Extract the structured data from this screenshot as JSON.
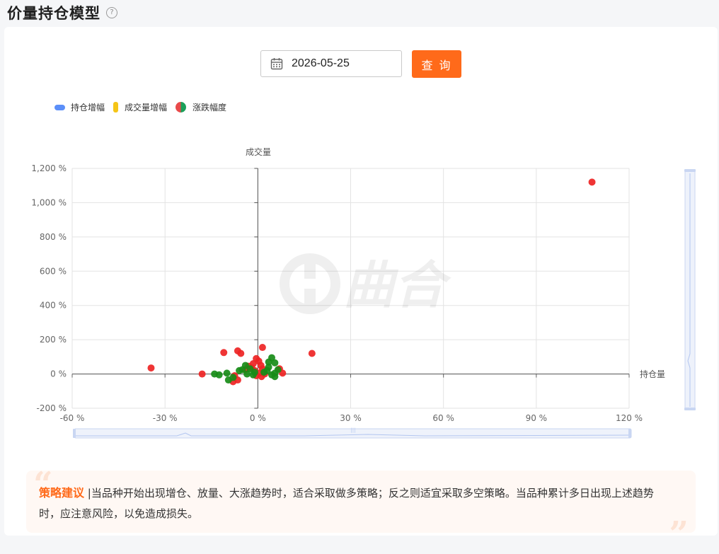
{
  "page": {
    "title": "价量持仓模型",
    "help_icon": "question-circle-icon"
  },
  "query": {
    "date_value": "2026-05-25",
    "button_label": "查 询",
    "calendar_icon": "calendar-icon"
  },
  "legend": [
    {
      "label": "持仓增幅",
      "color": "#5b8ff9",
      "icon": "rounded-bar-icon"
    },
    {
      "label": "成交量增幅",
      "color": "#f5c518",
      "icon": "vertical-bar-icon"
    },
    {
      "label": "涨跌幅度",
      "color": "#e84a4a",
      "icon": "half-red-half-green-circle-icon"
    }
  ],
  "watermark": "曲合",
  "chart_data": {
    "type": "scatter",
    "xlabel": "持仓量",
    "ylabel": "成交量",
    "xlim": [
      -60,
      120
    ],
    "ylim": [
      -200,
      1200
    ],
    "x_ticks": [
      -60,
      -30,
      0,
      30,
      60,
      90,
      120
    ],
    "y_ticks": [
      -200,
      0,
      200,
      400,
      600,
      800,
      1000,
      1200
    ],
    "x_tick_labels": [
      "-60 %",
      "-30 %",
      "0 %",
      "30 %",
      "60 %",
      "90 %",
      "120 %"
    ],
    "y_tick_labels": [
      "-200 %",
      "0 %",
      "200 %",
      "400 %",
      "600 %",
      "800 %",
      "1,000 %",
      "1,200 %"
    ],
    "grid": true,
    "colors": {
      "up": "#ee2424",
      "down": "#178c17"
    },
    "points": [
      {
        "x": 108,
        "y": 1120,
        "dir": "up"
      },
      {
        "x": -34.5,
        "y": 35,
        "dir": "up"
      },
      {
        "x": 17.5,
        "y": 120,
        "dir": "up"
      },
      {
        "x": -11,
        "y": 125,
        "dir": "up"
      },
      {
        "x": -6.5,
        "y": 135,
        "dir": "up"
      },
      {
        "x": -5.5,
        "y": 120,
        "dir": "up"
      },
      {
        "x": 1.5,
        "y": 155,
        "dir": "up"
      },
      {
        "x": -18,
        "y": 0,
        "dir": "up"
      },
      {
        "x": -7.5,
        "y": -10,
        "dir": "up"
      },
      {
        "x": -8,
        "y": -45,
        "dir": "up"
      },
      {
        "x": -6.5,
        "y": -35,
        "dir": "up"
      },
      {
        "x": -3,
        "y": 45,
        "dir": "up"
      },
      {
        "x": -1.5,
        "y": 60,
        "dir": "up"
      },
      {
        "x": -0.5,
        "y": 90,
        "dir": "up"
      },
      {
        "x": 0.3,
        "y": 75,
        "dir": "up"
      },
      {
        "x": 1,
        "y": 50,
        "dir": "up"
      },
      {
        "x": 1.5,
        "y": 30,
        "dir": "up"
      },
      {
        "x": -1,
        "y": 20,
        "dir": "up"
      },
      {
        "x": 0.5,
        "y": 5,
        "dir": "up"
      },
      {
        "x": 1.2,
        "y": -15,
        "dir": "up"
      },
      {
        "x": 2.2,
        "y": 0,
        "dir": "up"
      },
      {
        "x": -0.5,
        "y": -10,
        "dir": "up"
      },
      {
        "x": 7,
        "y": 30,
        "dir": "up"
      },
      {
        "x": 8,
        "y": 5,
        "dir": "up"
      },
      {
        "x": -2,
        "y": 35,
        "dir": "up"
      },
      {
        "x": -4,
        "y": 25,
        "dir": "up"
      },
      {
        "x": 4.5,
        "y": 95,
        "dir": "down"
      },
      {
        "x": 5.5,
        "y": 65,
        "dir": "down"
      },
      {
        "x": 3.5,
        "y": 70,
        "dir": "down"
      },
      {
        "x": 3.5,
        "y": 40,
        "dir": "down"
      },
      {
        "x": 6.5,
        "y": 25,
        "dir": "down"
      },
      {
        "x": 5.5,
        "y": 5,
        "dir": "down"
      },
      {
        "x": 5.5,
        "y": -15,
        "dir": "down"
      },
      {
        "x": 4.5,
        "y": -5,
        "dir": "down"
      },
      {
        "x": 3,
        "y": 20,
        "dir": "down"
      },
      {
        "x": 2,
        "y": 10,
        "dir": "down"
      },
      {
        "x": -14,
        "y": 0,
        "dir": "down"
      },
      {
        "x": -12.5,
        "y": -5,
        "dir": "down"
      },
      {
        "x": -10,
        "y": 5,
        "dir": "down"
      },
      {
        "x": -9.5,
        "y": -35,
        "dir": "down"
      },
      {
        "x": -8,
        "y": -20,
        "dir": "down"
      },
      {
        "x": -6,
        "y": 20,
        "dir": "down"
      },
      {
        "x": -5,
        "y": 25,
        "dir": "down"
      },
      {
        "x": -4,
        "y": 50,
        "dir": "down"
      },
      {
        "x": -3.5,
        "y": 0,
        "dir": "down"
      },
      {
        "x": -2.5,
        "y": 30,
        "dir": "down"
      },
      {
        "x": -1.5,
        "y": -5,
        "dir": "down"
      },
      {
        "x": -1,
        "y": 10,
        "dir": "down"
      }
    ]
  },
  "strategy": {
    "label": "策略建议",
    "text": " |当品种开始出现增仓、放量、大涨趋势时，适合采取做多策略；反之则适宜采取多空策略。当品种累计多日出现上述趋势时，应注意风险，以免造成损失。"
  }
}
